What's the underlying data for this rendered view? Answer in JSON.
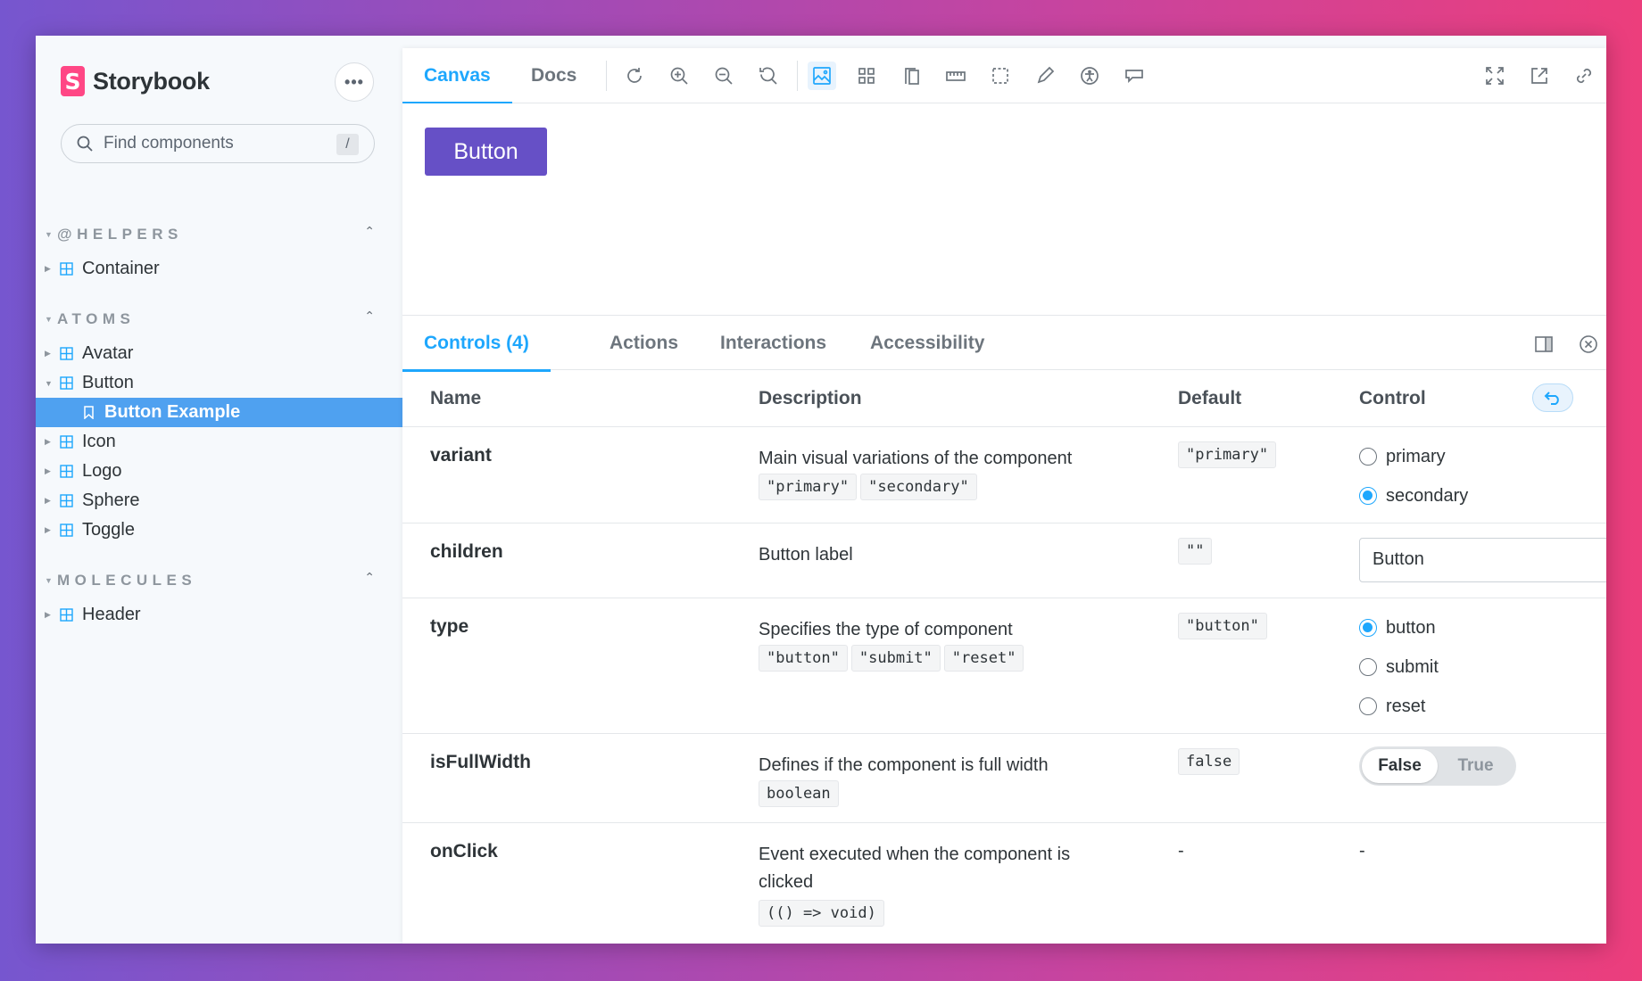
{
  "brand": {
    "logo_letter": "S",
    "name": "Storybook"
  },
  "sidebar": {
    "menu_label": "•••",
    "search": {
      "placeholder": "Find components",
      "shortcut": "/"
    },
    "groups": [
      {
        "title": "@HELPERS",
        "items": [
          {
            "label": "Container"
          }
        ]
      },
      {
        "title": "ATOMS",
        "items": [
          {
            "label": "Avatar"
          },
          {
            "label": "Button",
            "expanded": true,
            "stories": [
              {
                "label": "Button Example",
                "selected": true
              }
            ]
          },
          {
            "label": "Icon"
          },
          {
            "label": "Logo"
          },
          {
            "label": "Sphere"
          },
          {
            "label": "Toggle"
          }
        ]
      },
      {
        "title": "MOLECULES",
        "items": [
          {
            "label": "Header"
          }
        ]
      }
    ]
  },
  "toolbar": {
    "tabs": [
      {
        "label": "Canvas",
        "active": true
      },
      {
        "label": "Docs"
      }
    ],
    "icons": [
      "reload-icon",
      "zoom-in-icon",
      "zoom-out-icon",
      "zoom-reset-icon",
      "background-icon",
      "grid-icon",
      "viewport-icon",
      "measure-icon",
      "outline-icon",
      "pencil-icon",
      "accessibility-icon",
      "speech-icon"
    ],
    "right_icons": [
      "fullscreen-icon",
      "open-new-tab-icon",
      "link-icon"
    ]
  },
  "canvas": {
    "button_label": "Button",
    "button_color": "#6650c6"
  },
  "addons": {
    "tabs": [
      {
        "label": "Controls (4)",
        "active": true
      },
      {
        "label": "Actions"
      },
      {
        "label": "Interactions"
      },
      {
        "label": "Accessibility"
      }
    ]
  },
  "controls": {
    "headers": {
      "name": "Name",
      "description": "Description",
      "default": "Default",
      "control": "Control"
    },
    "rows": [
      {
        "name": "variant",
        "description": "Main visual variations of the component",
        "types": [
          "\"primary\"",
          "\"secondary\""
        ],
        "default": "\"primary\"",
        "control": {
          "kind": "radio",
          "options": [
            "primary",
            "secondary"
          ],
          "selected": "secondary"
        }
      },
      {
        "name": "children",
        "description": "Button label",
        "types": [],
        "default": "\"\"",
        "control": {
          "kind": "text",
          "value": "Button"
        }
      },
      {
        "name": "type",
        "description": "Specifies the type of component",
        "types": [
          "\"button\"",
          "\"submit\"",
          "\"reset\""
        ],
        "default": "\"button\"",
        "control": {
          "kind": "radio",
          "options": [
            "button",
            "submit",
            "reset"
          ],
          "selected": "button"
        }
      },
      {
        "name": "isFullWidth",
        "description": "Defines if the component is full width",
        "types": [
          "boolean"
        ],
        "default": "false",
        "control": {
          "kind": "boolean",
          "false_label": "False",
          "true_label": "True",
          "value": false
        }
      },
      {
        "name": "onClick",
        "description": "Event executed when the component is clicked",
        "types": [
          "(() => void)"
        ],
        "default": "-",
        "control": {
          "kind": "none",
          "value": "-"
        }
      }
    ]
  },
  "colors": {
    "accent": "#1ea7fd",
    "selected_bg": "#4fa1f0",
    "brand": "#ff4785"
  }
}
